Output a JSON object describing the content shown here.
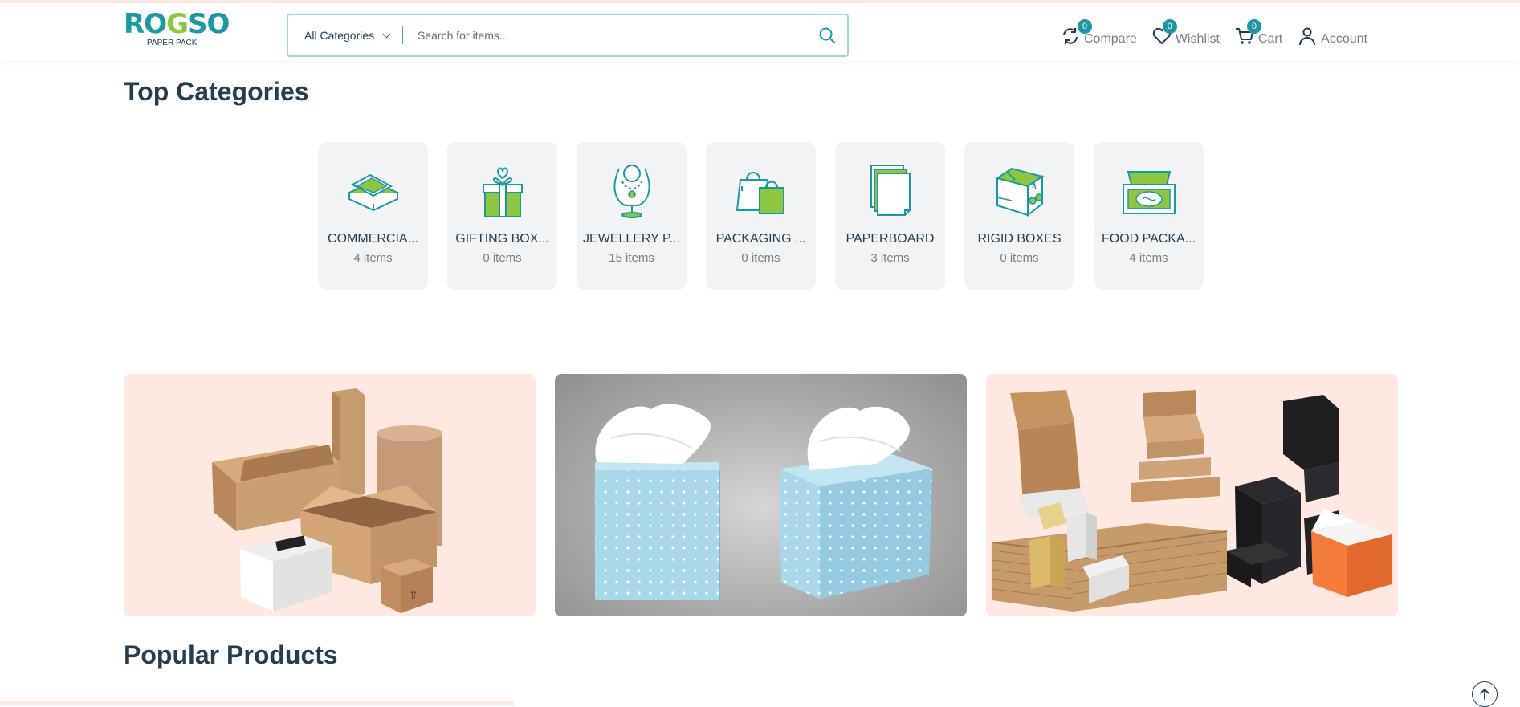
{
  "brand": {
    "logo_text": "ROGSO",
    "logo_sub": "PAPER PACK"
  },
  "search": {
    "category_label": "All Categories",
    "placeholder": "Search for items..."
  },
  "header_actions": [
    {
      "label": "Compare",
      "badge": "0",
      "icon": "compare-icon"
    },
    {
      "label": "Wishlist",
      "badge": "0",
      "icon": "heart-icon"
    },
    {
      "label": "Cart",
      "badge": "0",
      "icon": "cart-icon"
    },
    {
      "label": "Account",
      "icon": "user-icon"
    }
  ],
  "top_categories": {
    "title": "Top Categories",
    "items": [
      {
        "name": "COMMERCIA...",
        "count": "4 items",
        "icon": "open-box-icon"
      },
      {
        "name": "GIFTING BOX...",
        "count": "0 items",
        "icon": "gift-box-icon"
      },
      {
        "name": "JEWELLERY P...",
        "count": "15 items",
        "icon": "necklace-icon"
      },
      {
        "name": "PACKAGING ...",
        "count": "0 items",
        "icon": "shopping-bags-icon"
      },
      {
        "name": "PAPERBOARD",
        "count": "3 items",
        "icon": "paper-sheets-icon"
      },
      {
        "name": "RIGID BOXES",
        "count": "0 items",
        "icon": "rigid-box-icon"
      },
      {
        "name": "FOOD PACKA...",
        "count": "4 items",
        "icon": "food-box-icon"
      }
    ]
  },
  "banners": [
    {
      "name": "cardboard-boxes-banner"
    },
    {
      "name": "tissue-boxes-banner"
    },
    {
      "name": "mailer-boxes-banner"
    }
  ],
  "popular": {
    "title": "Popular Products"
  },
  "colors": {
    "accent": "#1a9aa0",
    "green": "#8dc63f",
    "heading": "#253d4e",
    "card_bg": "#f2f3f4",
    "banner_peach": "#fde9e2"
  }
}
